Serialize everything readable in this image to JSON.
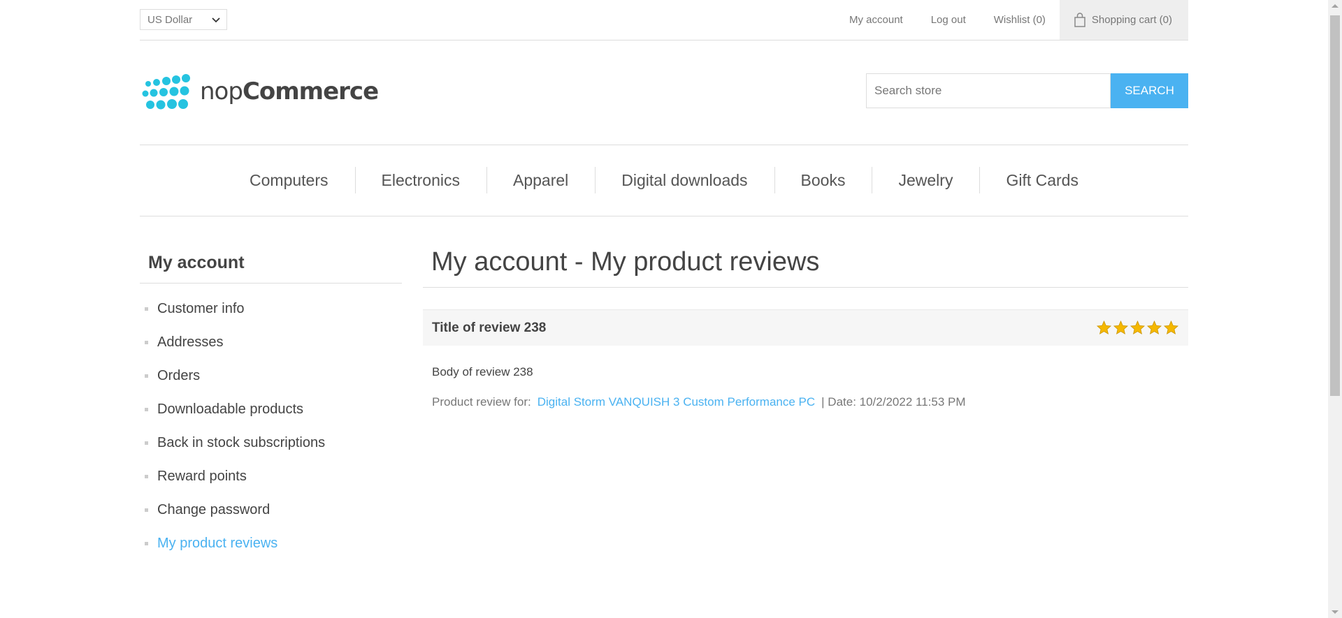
{
  "header": {
    "currency": "US Dollar",
    "links": {
      "my_account": "My account",
      "log_out": "Log out",
      "wishlist": "Wishlist (0)",
      "cart": "Shopping cart (0)"
    }
  },
  "logo": {
    "prefix": "nop",
    "suffix": "Commerce"
  },
  "search": {
    "placeholder": "Search store",
    "button": "SEARCH"
  },
  "menu": [
    "Computers",
    "Electronics",
    "Apparel",
    "Digital downloads",
    "Books",
    "Jewelry",
    "Gift Cards"
  ],
  "sidebar": {
    "title": "My account",
    "items": [
      {
        "label": "Customer info"
      },
      {
        "label": "Addresses"
      },
      {
        "label": "Orders"
      },
      {
        "label": "Downloadable products"
      },
      {
        "label": "Back in stock subscriptions"
      },
      {
        "label": "Reward points"
      },
      {
        "label": "Change password"
      },
      {
        "label": "My product reviews"
      }
    ]
  },
  "main": {
    "title": "My account - My product reviews",
    "review": {
      "title": "Title of review 238",
      "rating": 5,
      "body": "Body of review 238",
      "product_label": "Product review for:",
      "product_name": "Digital Storm VANQUISH 3 Custom Performance PC",
      "date": "| Date: 10/2/2022 11:53 PM"
    }
  },
  "colors": {
    "accent": "#4ab2f1",
    "logo": "#25c3e0",
    "star": "#f5b800"
  }
}
